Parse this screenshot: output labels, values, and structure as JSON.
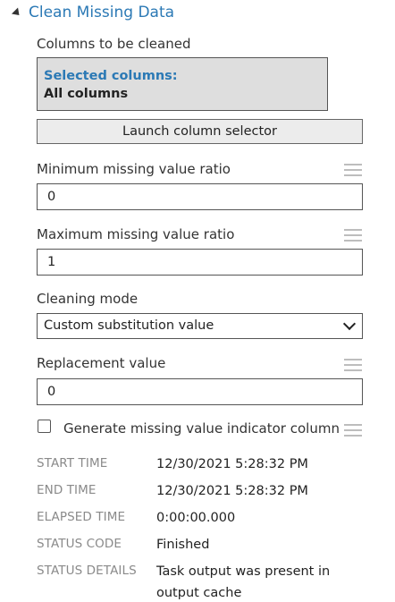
{
  "module": {
    "title": "Clean Missing Data"
  },
  "columns": {
    "label": "Columns to be cleaned",
    "selected_title": "Selected columns:",
    "selected_value": "All columns",
    "launch_label": "Launch column selector"
  },
  "min_ratio": {
    "label": "Minimum missing value ratio",
    "value": "0"
  },
  "max_ratio": {
    "label": "Maximum missing value ratio",
    "value": "1"
  },
  "cleaning_mode": {
    "label": "Cleaning mode",
    "selected": "Custom substitution value"
  },
  "replacement": {
    "label": "Replacement value",
    "value": "0"
  },
  "indicator": {
    "label": "Generate missing value indicator column",
    "checked": false
  },
  "run_info": {
    "start_time": {
      "key": "START TIME",
      "value": "12/30/2021 5:28:32 PM"
    },
    "end_time": {
      "key": "END TIME",
      "value": "12/30/2021 5:28:32 PM"
    },
    "elapsed_time": {
      "key": "ELAPSED TIME",
      "value": "0:00:00.000"
    },
    "status_code": {
      "key": "STATUS CODE",
      "value": "Finished"
    },
    "status_details": {
      "key": "STATUS DETAILS",
      "value_line1": "Task output was present in",
      "value_line2": "output cache"
    }
  },
  "colors": {
    "accent": "#2b79b5",
    "box_bg": "#dedede",
    "muted": "#8a8a8a"
  },
  "icons": {
    "collapse": "caret-down-icon",
    "drag": "hamburger-icon",
    "dropdown": "chevron-down-icon"
  }
}
